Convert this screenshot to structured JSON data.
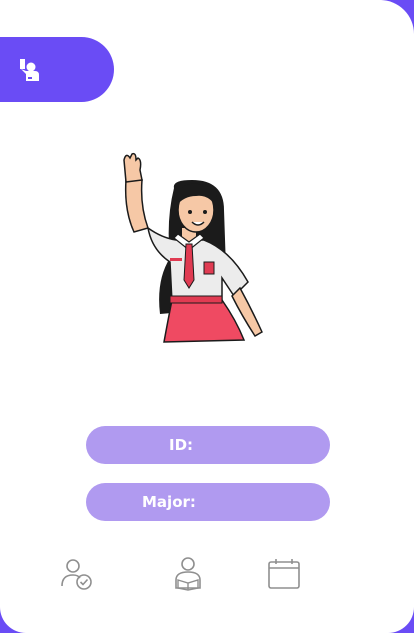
{
  "header": {
    "icon": "raised-hand-person-icon"
  },
  "illustration": {
    "subject": "student-waving",
    "colors": {
      "shirt": "#ececec",
      "tie": "#e03b52",
      "skirt": "#ef4a62",
      "hair": "#1b1b1b",
      "skin": "#f6c8a6"
    }
  },
  "profile": {
    "id_label": "ID:",
    "id_value": "",
    "major_label": "Major:",
    "major_value": ""
  },
  "bottom_nav": {
    "items": [
      {
        "icon": "user-check-icon"
      },
      {
        "icon": "reader-person-icon"
      },
      {
        "icon": "calendar-icon"
      }
    ]
  },
  "colors": {
    "accent": "#6a4cf5",
    "pill": "#b09af0",
    "nav_icon": "#8f8f8f"
  }
}
